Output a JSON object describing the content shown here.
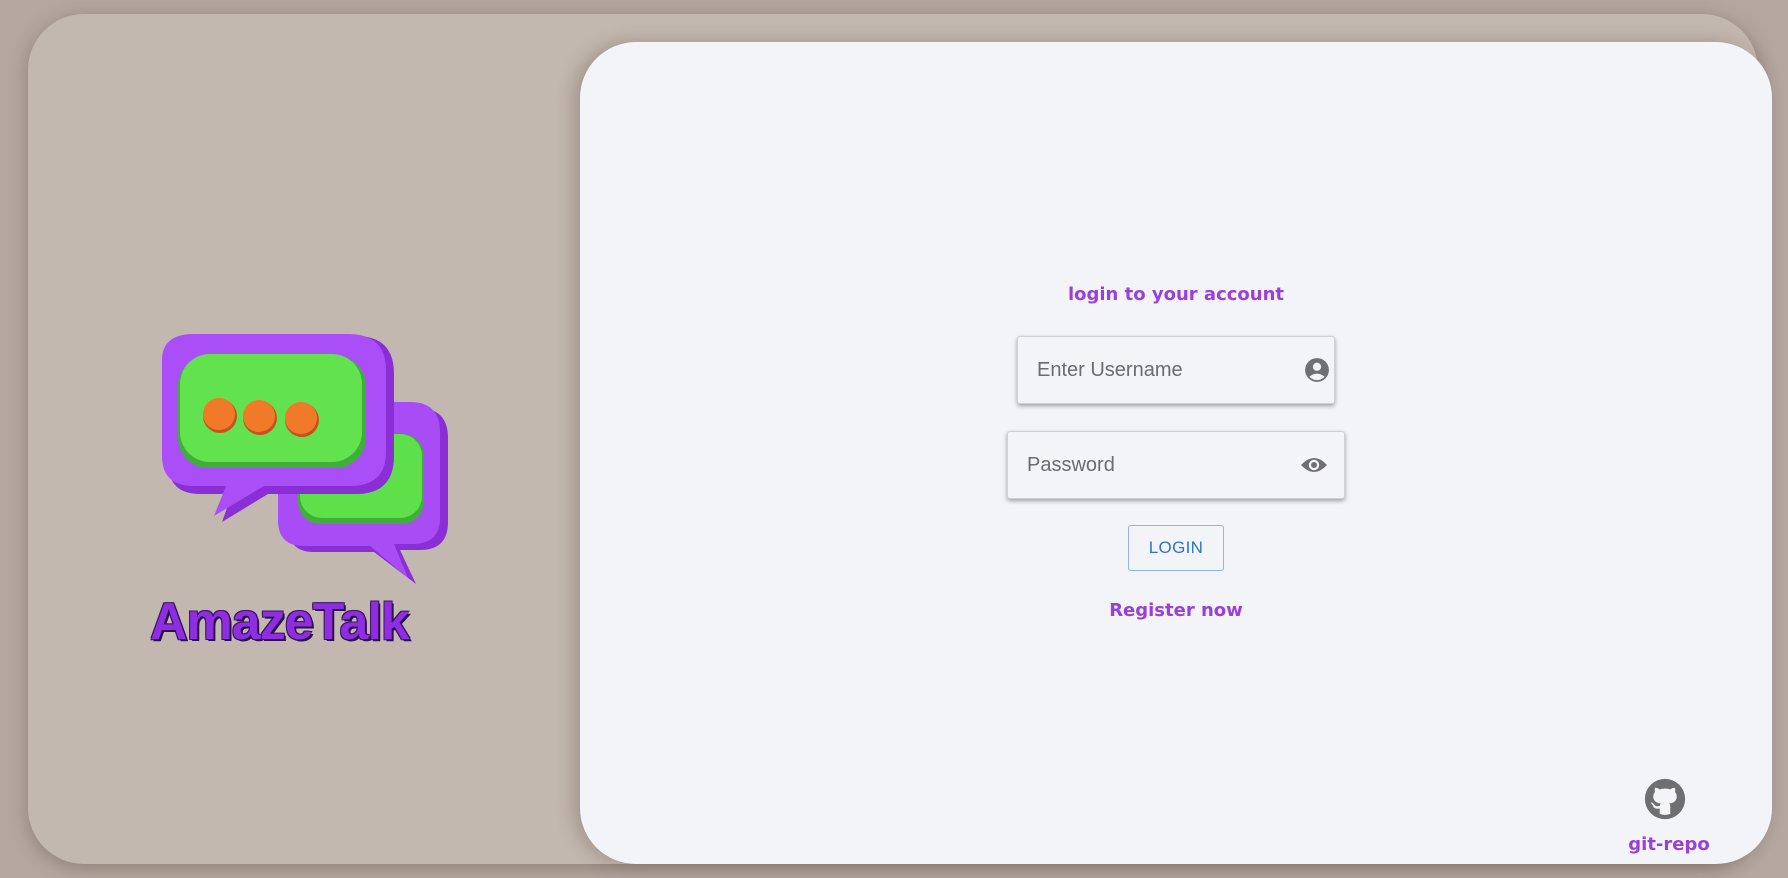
{
  "brand": {
    "name": "AmazeTalk",
    "logo_icon": "chat-bubbles-icon",
    "colors": {
      "purple": "#8e2de2",
      "green": "#5ee04a",
      "orange": "#f07a2a"
    }
  },
  "login": {
    "heading": "login to your account",
    "username": {
      "placeholder": "Enter Username",
      "value": "",
      "icon": "account-circle-icon"
    },
    "password": {
      "placeholder": "Password",
      "value": "",
      "icon": "eye-icon"
    },
    "login_button": "LOGIN",
    "register_link": "Register now"
  },
  "footer": {
    "git_icon": "github-icon",
    "git_label": "git-repo"
  },
  "theme": {
    "background": "#c3b8af",
    "panel": "#f3f4f8",
    "accent": "#9b3fd8",
    "button_text": "#2f74c8"
  }
}
